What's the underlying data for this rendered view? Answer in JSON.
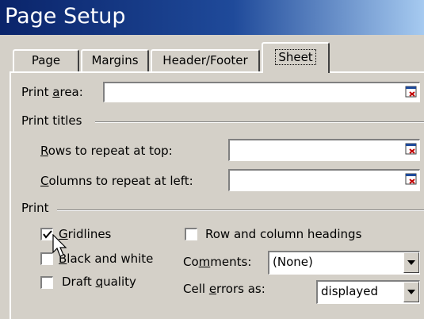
{
  "window": {
    "title": "Page Setup"
  },
  "tabs": [
    {
      "label": "Page"
    },
    {
      "label": "Margins"
    },
    {
      "label": "Header/Footer"
    },
    {
      "label": "Sheet"
    }
  ],
  "print_area": {
    "label_pre": "Print ",
    "label_key": "a",
    "label_post": "rea:",
    "value": ""
  },
  "print_titles": {
    "heading": "Print titles",
    "rows": {
      "label_key": "R",
      "label_post": "ows to repeat at top:",
      "value": ""
    },
    "columns": {
      "label_key": "C",
      "label_post": "olumns to repeat at left:",
      "value": ""
    }
  },
  "print": {
    "heading": "Print",
    "gridlines": {
      "label_key": "G",
      "label_post": "ridlines",
      "checked": true
    },
    "black_white": {
      "label_key": "B",
      "label_post": "lack and white",
      "checked": false
    },
    "draft": {
      "label_pre": "Draft ",
      "label_key": "q",
      "label_post": "uality",
      "checked": false
    },
    "row_col_headings": {
      "label": "Row and column headings",
      "checked": false
    },
    "comments": {
      "label_pre": "Co",
      "label_key": "m",
      "label_post": "ments:",
      "value": "(None)"
    },
    "cell_errors": {
      "label_pre": "Cell ",
      "label_key": "e",
      "label_post": "rrors as:",
      "value": "displayed"
    }
  },
  "icons": {
    "ref_button": "collapse-dialog-icon",
    "dropdown": "chevron-down-icon",
    "cursor": "mouse-pointer-icon"
  }
}
